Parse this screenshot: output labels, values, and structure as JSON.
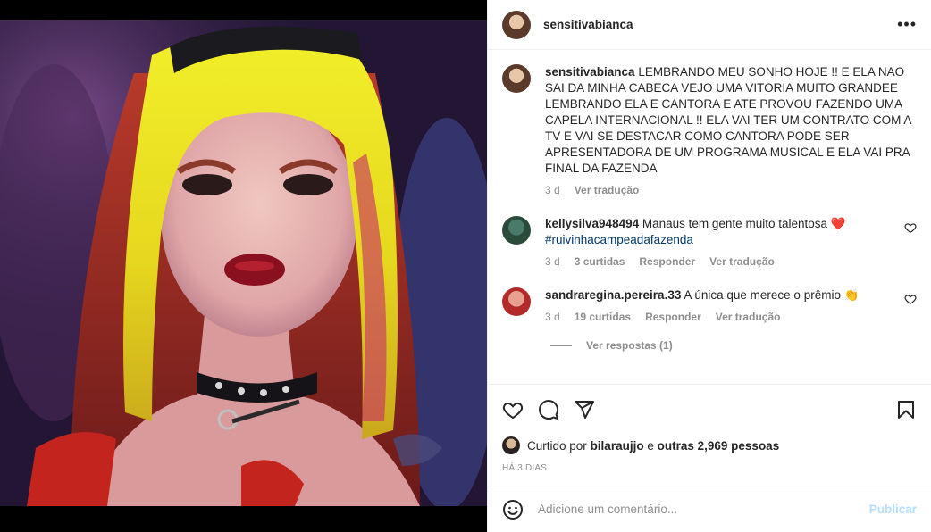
{
  "post": {
    "author": "sensitivabianca",
    "caption": {
      "username": "sensitivabianca",
      "text": "LEMBRANDO MEU SONHO HOJE !! E ELA NAO SAI DA MINHA CABECA VEJO UMA VITORIA MUITO GRANDEE LEMBRANDO ELA E CANTORA E ATE PROVOU FAZENDO UMA CAPELA INTERNACIONAL !! ELA VAI TER UM CONTRATO COM A TV E VAI SE DESTACAR COMO CANTORA PODE SER APRESENTADORA DE UM PROGRAMA MUSICAL E ELA VAI PRA FINAL DA FAZENDA",
      "age": "3 d",
      "translate": "Ver tradução"
    },
    "comments": [
      {
        "username": "kellysilva948494",
        "text": "Manaus tem gente muito talentosa ❤️",
        "hashtag": "#ruivinhacampeadafazenda",
        "age": "3 d",
        "likes": "3 curtidas",
        "reply": "Responder",
        "translate": "Ver tradução"
      },
      {
        "username": "sandraregina.pereira.33",
        "text": "A única que merece o prêmio 👏",
        "age": "3 d",
        "likes": "19 curtidas",
        "reply": "Responder",
        "translate": "Ver tradução",
        "view_replies": "Ver respostas (1)"
      }
    ],
    "liked_by": {
      "prefix": "Curtido por",
      "user": "bilaraujjo",
      "connector": "e",
      "others": "outras 2,969 pessoas"
    },
    "timestamp": "HÁ 3 DIAS",
    "add_comment": {
      "placeholder": "Adicione um comentário...",
      "publish": "Publicar"
    }
  },
  "colors": {
    "text": "#262626",
    "muted": "#8e8e8e",
    "link": "#00376b",
    "publish_disabled": "#b2dffc",
    "heart": "#ed4956"
  },
  "icons": {
    "more": "more-horizontal-icon",
    "like": "heart-icon",
    "comment": "comment-icon",
    "share": "paper-plane-icon",
    "save": "bookmark-icon",
    "emoji": "emoji-icon"
  }
}
